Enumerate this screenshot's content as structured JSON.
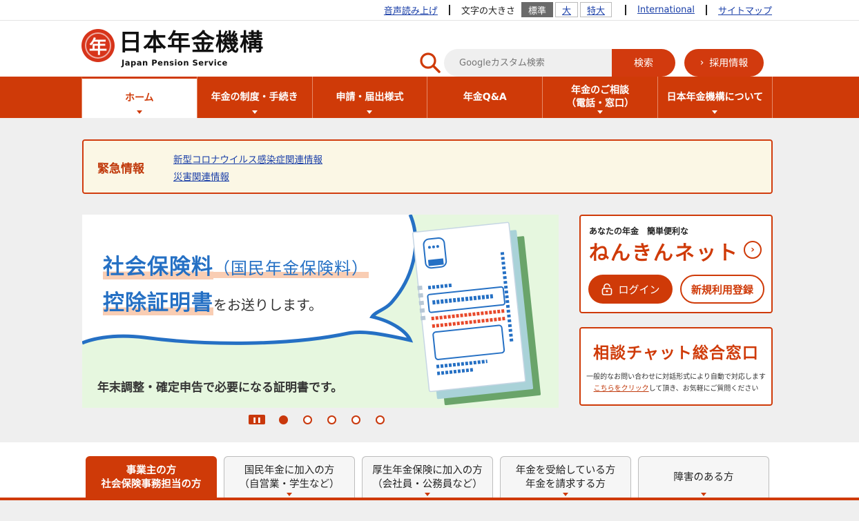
{
  "utility": {
    "read_aloud": "音声読み上げ",
    "font_size_label": "文字の大きさ",
    "font_sizes": [
      "標準",
      "大",
      "特大"
    ],
    "international": "International",
    "sitemap": "サイトマップ"
  },
  "header": {
    "logo_ja": "日本年金機構",
    "logo_en": "Japan Pension Service",
    "logo_mark": "年",
    "search_placeholder": "Googleカスタム検索",
    "search_button": "検索",
    "recruit_button": "採用情報"
  },
  "nav": [
    {
      "line1": "ホーム",
      "line2": ""
    },
    {
      "line1": "年金の制度・手続き",
      "line2": ""
    },
    {
      "line1": "申請・届出様式",
      "line2": ""
    },
    {
      "line1": "年金Q&A",
      "line2": ""
    },
    {
      "line1": "年金のご相談",
      "line2": "（電話・窓口）"
    },
    {
      "line1": "日本年金機構について",
      "line2": ""
    }
  ],
  "urgent": {
    "title": "緊急情報",
    "links": [
      "新型コロナウイルス感染症関連情報",
      "災害関連情報"
    ]
  },
  "banner": {
    "headline_main": "社会保険料",
    "headline_sub": "（国民年金保険料）",
    "headline2_main": "控除証明書",
    "headline2_tail": "をお送りします。",
    "caption": "年末調整・確定申告で必要になる証明書です。",
    "slide_count": 5,
    "active_slide": 1
  },
  "nenkin_net": {
    "tagline": "あなたの年金　簡単便利な",
    "name": "ねんきんネット",
    "login": "ログイン",
    "register": "新規利用登録"
  },
  "chat": {
    "title": "相談チャット総合窓口",
    "desc1": "一般的なお問い合わせに対話形式により自動で対応します",
    "link": "こちらをクリック",
    "desc2": "して頂き、お気軽にご質問ください"
  },
  "audience_tabs": [
    {
      "line1": "事業主の方",
      "line2": "社会保険事務担当の方"
    },
    {
      "line1": "国民年金に加入の方",
      "line2": "（自営業・学生など）"
    },
    {
      "line1": "厚生年金保険に加入の方",
      "line2": "（会社員・公務員など）"
    },
    {
      "line1": "年金を受給している方",
      "line2": "年金を請求する方"
    },
    {
      "line1": "障害のある方",
      "line2": ""
    }
  ],
  "colors": {
    "brand": "#cf3a08",
    "link": "#1a3fa8",
    "banner_bg": "#e6f7df",
    "banner_text": "#2570c4"
  }
}
